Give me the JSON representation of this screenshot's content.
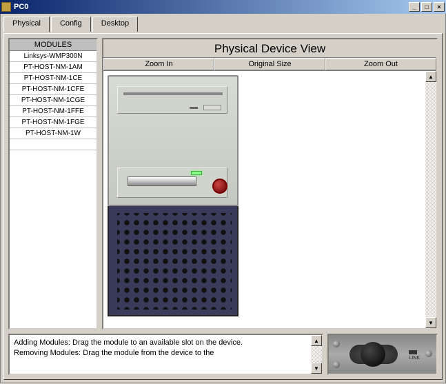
{
  "titlebar": {
    "title": "PC0"
  },
  "tabs": [
    {
      "label": "Physical",
      "active": true
    },
    {
      "label": "Config",
      "active": false
    },
    {
      "label": "Desktop",
      "active": false
    }
  ],
  "modules": {
    "header": "MODULES",
    "items": [
      "Linksys-WMP300N",
      "PT-HOST-NM-1AM",
      "PT-HOST-NM-1CE",
      "PT-HOST-NM-1CFE",
      "PT-HOST-NM-1CGE",
      "PT-HOST-NM-1FFE",
      "PT-HOST-NM-1FGE",
      "PT-HOST-NM-1W"
    ]
  },
  "device_view": {
    "title": "Physical Device View",
    "zoom": {
      "in": "Zoom In",
      "orig": "Original Size",
      "out": "Zoom Out"
    }
  },
  "help": {
    "line1": "Adding Modules: Drag the module to an available slot on the device.",
    "line2": "Removing Modules: Drag the module from the device to the"
  },
  "power_panel": {
    "link_label": "LINK"
  }
}
